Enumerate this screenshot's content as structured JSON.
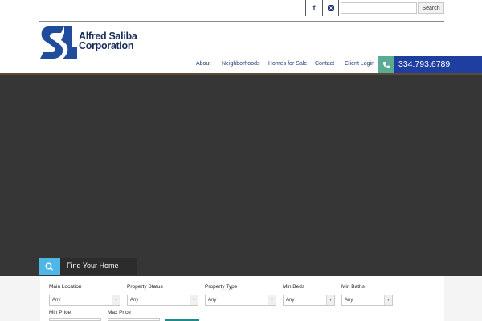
{
  "topbar": {
    "social": [
      {
        "name": "facebook-icon",
        "glyph": "f"
      },
      {
        "name": "instagram-icon",
        "glyph": "⌷"
      }
    ],
    "search": {
      "value": "",
      "placeholder": "",
      "button_label": "Search"
    }
  },
  "brand": {
    "line1": "Alfred Saliba",
    "line2": "Corporation",
    "color": "#1a2e5a"
  },
  "nav": {
    "items": [
      "About",
      "Neighborhoods",
      "Homes for Sale",
      "Contact",
      "Client Login"
    ],
    "phone": "334.793.6789",
    "phone_bg": "#1e3fa0",
    "phone_icon_bg": "#5aab94"
  },
  "hero": {
    "bg": "#363636"
  },
  "find_home": {
    "label": "Find Your Home",
    "icon": "search-icon",
    "accent": "#4fb7e6"
  },
  "search_form": {
    "fields": [
      {
        "label": "Main Location",
        "value": "Any"
      },
      {
        "label": "Property Status",
        "value": "Any"
      },
      {
        "label": "Property Type",
        "value": "Any"
      },
      {
        "label": "Min Beds",
        "value": "Any"
      },
      {
        "label": "Min Baths",
        "value": "Any"
      }
    ],
    "price_fields": [
      {
        "label": "Min Price"
      },
      {
        "label": "Max Price"
      }
    ]
  }
}
